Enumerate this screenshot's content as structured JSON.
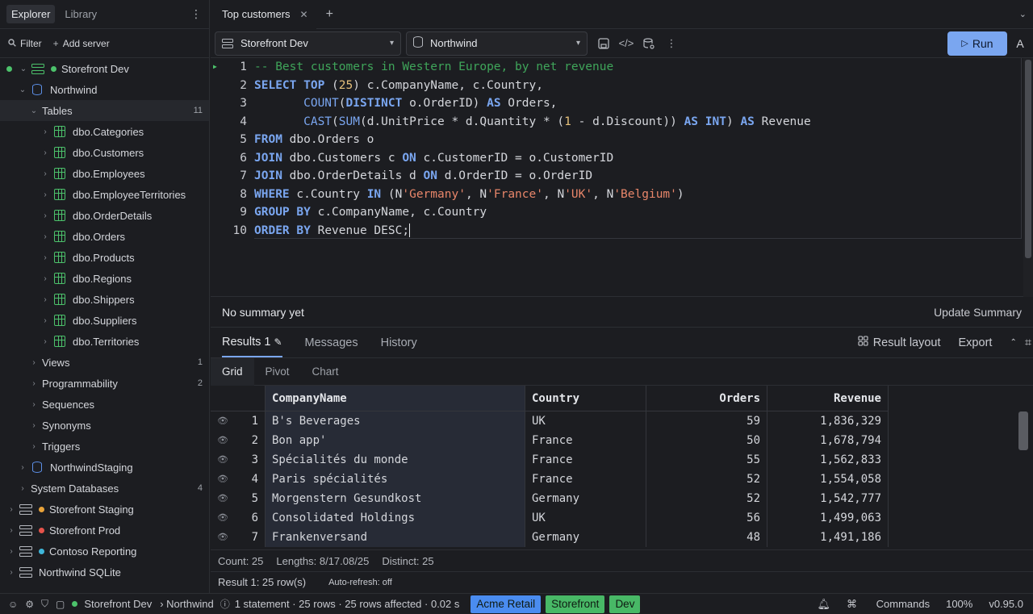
{
  "sidebar": {
    "tabs": [
      "Explorer",
      "Library"
    ],
    "filter_label": "Filter",
    "add_server_label": "Add server",
    "tree": [
      {
        "label": "Storefront Dev",
        "type": "server",
        "status_color": "#4cc26b",
        "connected": true
      },
      {
        "label": "Northwind",
        "type": "database"
      },
      {
        "label": "Tables",
        "type": "folder",
        "count": "11"
      },
      {
        "label": "dbo.Categories",
        "type": "table"
      },
      {
        "label": "dbo.Customers",
        "type": "table"
      },
      {
        "label": "dbo.Employees",
        "type": "table"
      },
      {
        "label": "dbo.EmployeeTerritories",
        "type": "table"
      },
      {
        "label": "dbo.OrderDetails",
        "type": "table"
      },
      {
        "label": "dbo.Orders",
        "type": "table"
      },
      {
        "label": "dbo.Products",
        "type": "table"
      },
      {
        "label": "dbo.Regions",
        "type": "table"
      },
      {
        "label": "dbo.Shippers",
        "type": "table"
      },
      {
        "label": "dbo.Suppliers",
        "type": "table"
      },
      {
        "label": "dbo.Territories",
        "type": "table"
      },
      {
        "label": "Views",
        "type": "folder",
        "count": "1"
      },
      {
        "label": "Programmability",
        "type": "folder",
        "count": "2"
      },
      {
        "label": "Sequences",
        "type": "folder",
        "count": ""
      },
      {
        "label": "Synonyms",
        "type": "folder",
        "count": ""
      },
      {
        "label": "Triggers",
        "type": "folder",
        "count": ""
      },
      {
        "label": "NorthwindStaging",
        "type": "database"
      },
      {
        "label": "System Databases",
        "type": "folder",
        "count": "4"
      },
      {
        "label": "Storefront Staging",
        "type": "server",
        "status_color": "#e8a33a"
      },
      {
        "label": "Storefront Prod",
        "type": "server",
        "status_color": "#e5534b"
      },
      {
        "label": "Contoso Reporting",
        "type": "server",
        "status_color": "#3fb6d9"
      },
      {
        "label": "Northwind SQLite",
        "type": "server",
        "status_color": ""
      }
    ]
  },
  "editor_tab": {
    "title": "Top customers"
  },
  "toolbar": {
    "server": "Storefront Dev",
    "database": "Northwind",
    "run_label": "Run",
    "font_label": "A"
  },
  "editor": {
    "lines": [
      "-- Best customers in Western Europe, by net revenue",
      "SELECT TOP (25) c.CompanyName, c.Country,",
      "       COUNT(DISTINCT o.OrderID) AS Orders,",
      "       CAST(SUM(d.UnitPrice * d.Quantity * (1 - d.Discount)) AS INT) AS Revenue",
      "FROM dbo.Orders o",
      "JOIN dbo.Customers c ON c.CustomerID = o.CustomerID",
      "JOIN dbo.OrderDetails d ON d.OrderID = o.OrderID",
      "WHERE c.Country IN (N'Germany', N'France', N'UK', N'Belgium')",
      "GROUP BY c.CompanyName, c.Country",
      "ORDER BY Revenue DESC;"
    ]
  },
  "summary": {
    "text": "No summary yet",
    "update_label": "Update Summary"
  },
  "results": {
    "tabs": [
      "Results 1",
      "Messages",
      "History"
    ],
    "result_layout_label": "Result layout",
    "export_label": "Export",
    "sub_tabs": [
      "Grid",
      "Pivot",
      "Chart"
    ],
    "columns": [
      "CompanyName",
      "Country",
      "Orders",
      "Revenue"
    ],
    "rows": [
      [
        "1",
        "B's Beverages",
        "UK",
        "59",
        "1,836,329"
      ],
      [
        "2",
        "Bon app'",
        "France",
        "50",
        "1,678,794"
      ],
      [
        "3",
        "Spécialités du monde",
        "France",
        "55",
        "1,562,833"
      ],
      [
        "4",
        "Paris spécialités",
        "France",
        "52",
        "1,554,058"
      ],
      [
        "5",
        "Morgenstern Gesundkost",
        "Germany",
        "52",
        "1,542,777"
      ],
      [
        "6",
        "Consolidated Holdings",
        "UK",
        "56",
        "1,499,063"
      ],
      [
        "7",
        "Frankenversand",
        "Germany",
        "48",
        "1,491,186"
      ]
    ],
    "stats": {
      "count": "Count: 25",
      "lengths": "Lengths: 8/17.08/25",
      "distinct": "Distinct: 25"
    },
    "footer": {
      "rows": "Result 1: 25 row(s)",
      "auto_refresh": "Auto-refresh: off"
    }
  },
  "statusbar": {
    "server": "Storefront Dev",
    "database": "› Northwind",
    "info": "1 statement · 25 rows · 25 rows affected · 0.02 s",
    "badges": [
      {
        "label": "Acme Retail",
        "color": "#4a8cf0"
      },
      {
        "label": "Storefront",
        "color": "#48b866"
      },
      {
        "label": "Dev",
        "color": "#48b866"
      }
    ],
    "commands_label": "Commands",
    "zoom": "100%",
    "version": "v0.95.0"
  }
}
